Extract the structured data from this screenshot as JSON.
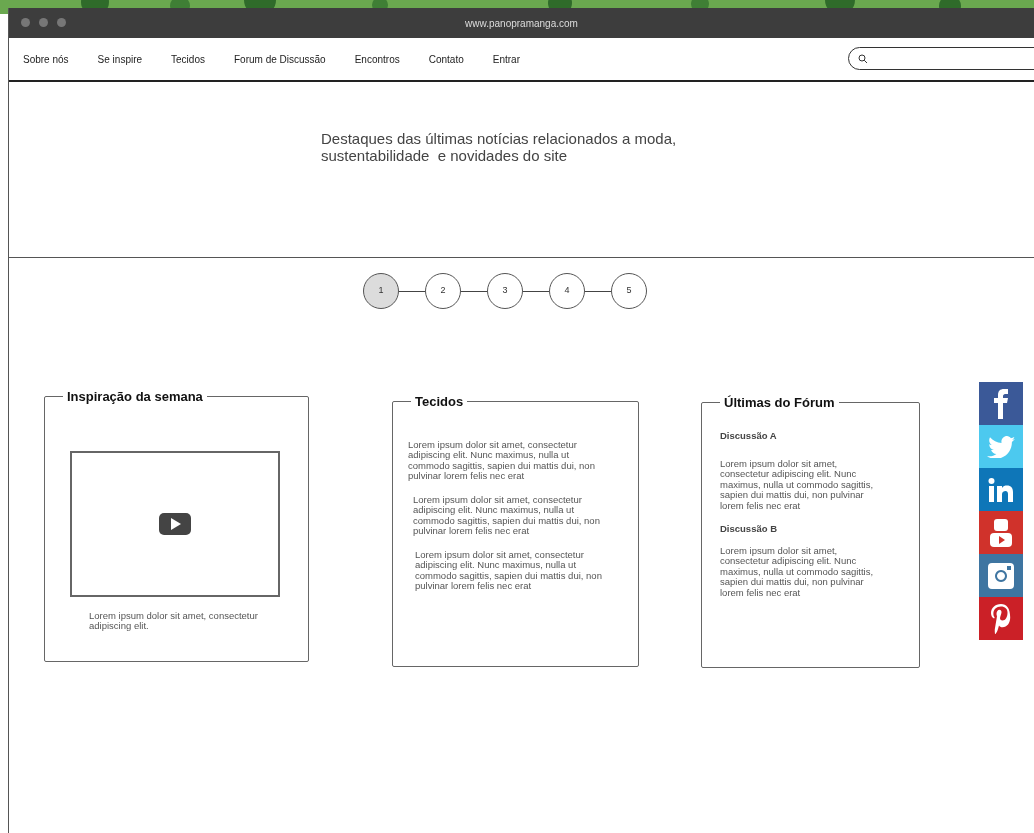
{
  "window": {
    "url": "www.panopramanga.com"
  },
  "nav": {
    "items": [
      {
        "label": "Sobre nós"
      },
      {
        "label": "Se inspire"
      },
      {
        "label": "Tecidos"
      },
      {
        "label": "Forum de Discussão"
      },
      {
        "label": "Encontros"
      },
      {
        "label": "Contato"
      },
      {
        "label": "Entrar"
      }
    ]
  },
  "hero": {
    "lines": [
      "Destaques das últimas notícias relacionados a moda,",
      "sustentabilidade  e novidades do site"
    ]
  },
  "stepper": [
    {
      "label": "1",
      "selected": true
    },
    {
      "label": "2",
      "selected": false
    },
    {
      "label": "3",
      "selected": false
    },
    {
      "label": "4",
      "selected": false
    },
    {
      "label": "5",
      "selected": false
    }
  ],
  "cards": [
    {
      "kind": "video",
      "title": "Inspiração da semana",
      "caption": "Lorem ipsum dolor sit amet, consectetur adipiscing elit."
    },
    {
      "kind": "text",
      "title": "Tecidos",
      "paragraphs": [
        "Lorem ipsum dolor sit amet, consectetur adipiscing elit. Nunc maximus, nulla ut commodo sagittis, sapien dui mattis dui, non pulvinar lorem felis nec erat",
        "Lorem ipsum dolor sit amet, consectetur adipiscing elit. Nunc maximus, nulla ut commodo sagittis, sapien dui mattis dui, non pulvinar lorem felis nec erat",
        "Lorem ipsum dolor sit amet, consectetur adipiscing elit. Nunc maximus, nulla ut commodo sagittis, sapien dui mattis dui, non pulvinar lorem felis nec erat"
      ]
    },
    {
      "kind": "forum",
      "title": "Últimas do Fórum",
      "posts": [
        {
          "title": "Discussão A",
          "body": "Lorem ipsum dolor sit amet, consectetur adipiscing elit. Nunc maximus, nulla ut commodo sagittis, sapien dui mattis dui, non pulvinar lorem felis nec erat"
        },
        {
          "title": "Discussão B",
          "body": "Lorem ipsum dolor sit amet, consectetur adipiscing elit. Nunc maximus, nulla ut commodo sagittis, sapien dui mattis dui, non pulvinar lorem felis nec erat"
        }
      ]
    }
  ]
}
